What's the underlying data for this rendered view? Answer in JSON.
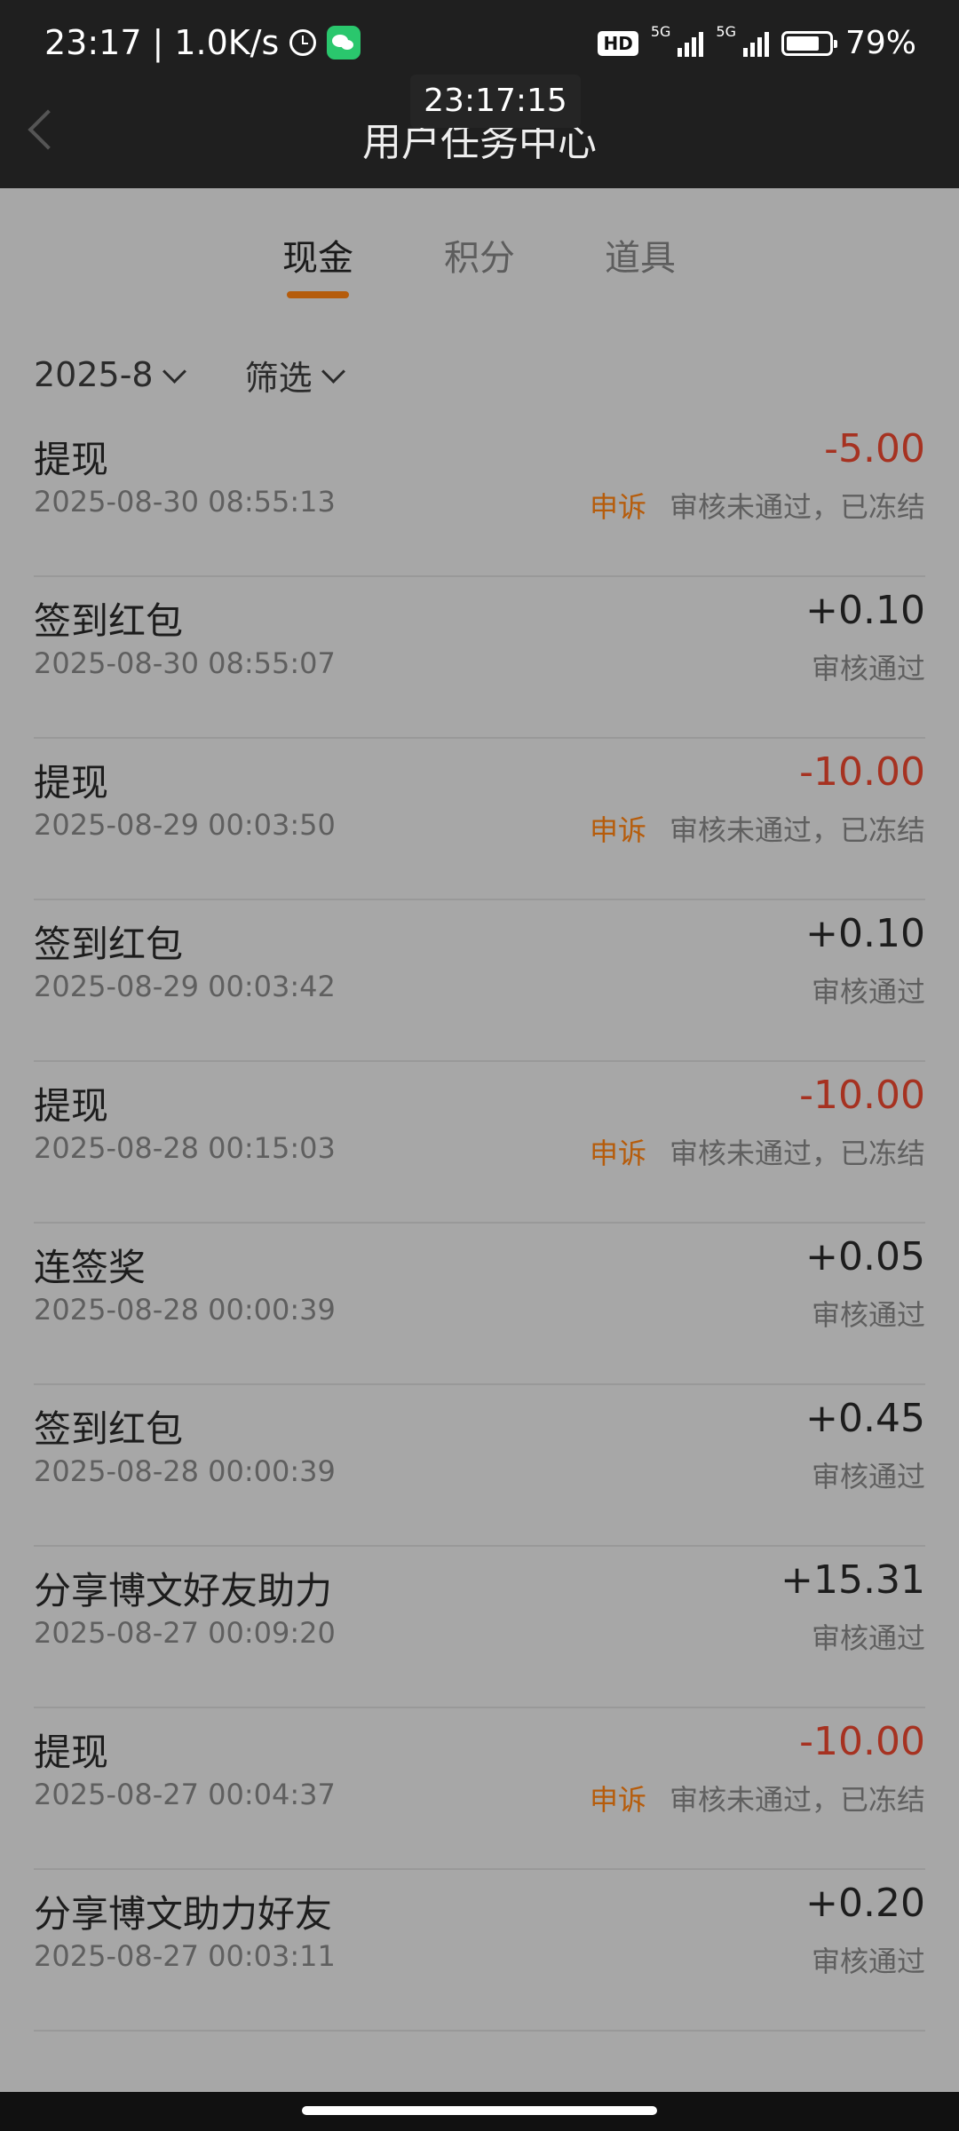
{
  "status_bar": {
    "time": "23:17",
    "separator": "|",
    "speed": "1.0K/s",
    "hd_label": "HD",
    "net1": "5G",
    "net2": "5G",
    "battery": "79%",
    "battery_level": 0.79,
    "icons": [
      "alarm-icon",
      "wechat-icon",
      "signal-icon",
      "battery-icon"
    ]
  },
  "header": {
    "title": "用户任务中心",
    "time_overlay": "23:17:15"
  },
  "tabs": [
    {
      "label": "现金",
      "active": true
    },
    {
      "label": "积分",
      "active": false
    },
    {
      "label": "道具",
      "active": false
    }
  ],
  "filters": {
    "month": "2025-8",
    "filter": "筛选"
  },
  "transactions": [
    {
      "title": "提现",
      "date": "2025-08-30 08:55:13",
      "amount": "-5.00",
      "appeal": "申诉",
      "status": "审核未通过，已冻结"
    },
    {
      "title": "签到红包",
      "date": "2025-08-30 08:55:07",
      "amount": "+0.10",
      "status": "审核通过"
    },
    {
      "title": "提现",
      "date": "2025-08-29 00:03:50",
      "amount": "-10.00",
      "appeal": "申诉",
      "status": "审核未通过，已冻结"
    },
    {
      "title": "签到红包",
      "date": "2025-08-29 00:03:42",
      "amount": "+0.10",
      "status": "审核通过"
    },
    {
      "title": "提现",
      "date": "2025-08-28 00:15:03",
      "amount": "-10.00",
      "appeal": "申诉",
      "status": "审核未通过，已冻结"
    },
    {
      "title": "连签奖",
      "date": "2025-08-28 00:00:39",
      "amount": "+0.05",
      "status": "审核通过"
    },
    {
      "title": "签到红包",
      "date": "2025-08-28 00:00:39",
      "amount": "+0.45",
      "status": "审核通过"
    },
    {
      "title": "分享博文好友助力",
      "date": "2025-08-27 00:09:20",
      "amount": "+15.31",
      "status": "审核通过"
    },
    {
      "title": "提现",
      "date": "2025-08-27 00:04:37",
      "amount": "-10.00",
      "appeal": "申诉",
      "status": "审核未通过，已冻结"
    },
    {
      "title": "分享博文助力好友",
      "date": "2025-08-27 00:03:11",
      "amount": "+0.20",
      "status": "审核通过"
    }
  ],
  "colors": {
    "accent": "#b55c0c",
    "negative": "#a63221",
    "background": "#a7a7a7",
    "header": "#1f1f1f"
  }
}
